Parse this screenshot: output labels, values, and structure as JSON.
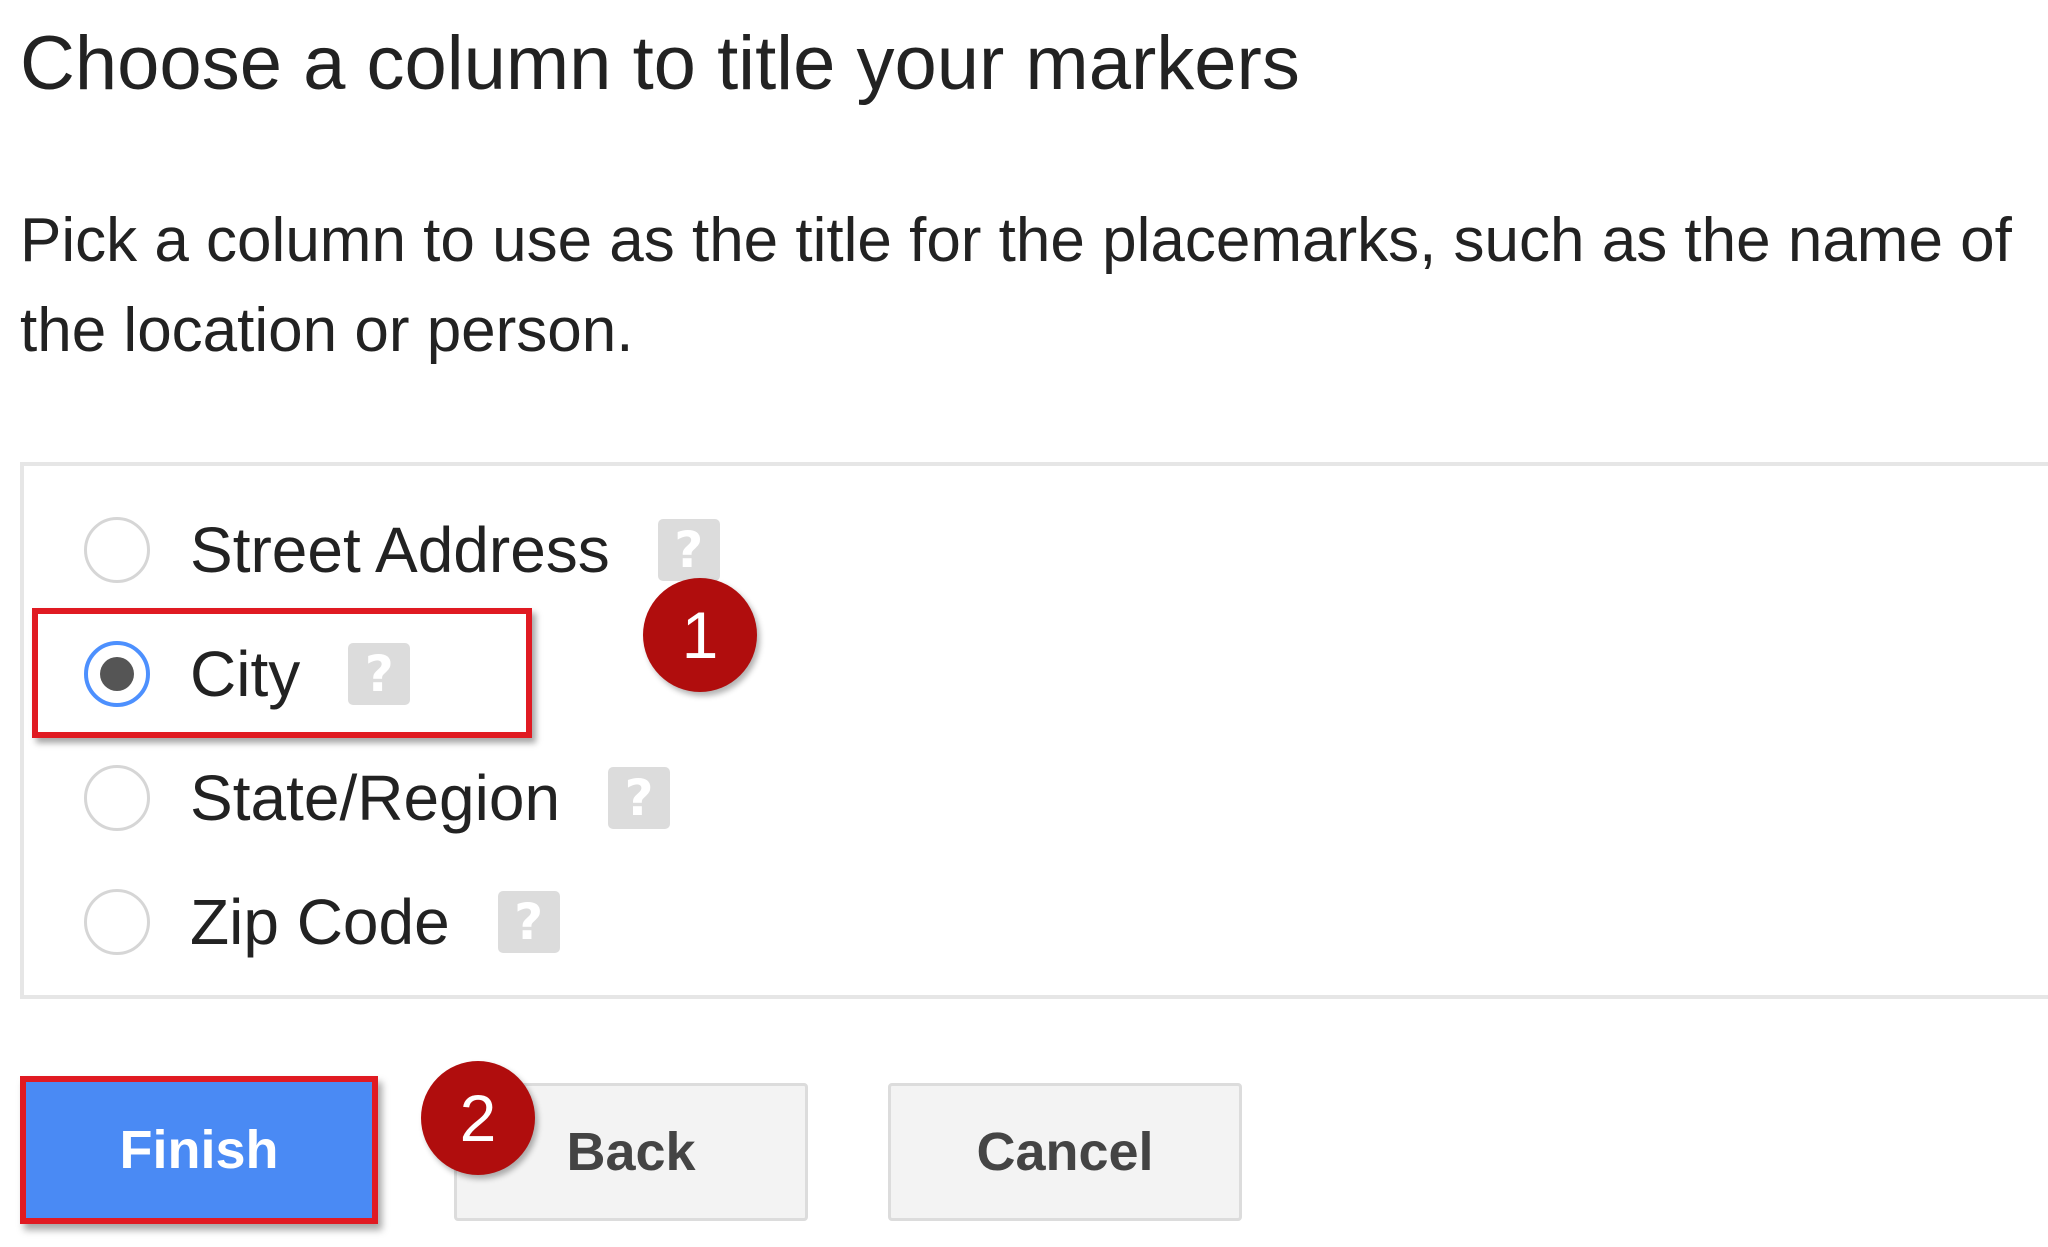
{
  "header": {
    "title": "Choose a column to title your markers"
  },
  "description": "Pick a column to use as the title for the placemarks, such as the name of the location or person.",
  "options": [
    {
      "label": "Street Address",
      "selected": false,
      "help_icon": "help-icon",
      "help_glyph": "?"
    },
    {
      "label": "City",
      "selected": true,
      "help_icon": "help-icon",
      "help_glyph": "?"
    },
    {
      "label": "State/Region",
      "selected": false,
      "help_icon": "help-icon",
      "help_glyph": "?"
    },
    {
      "label": "Zip Code",
      "selected": false,
      "help_icon": "help-icon",
      "help_glyph": "?"
    }
  ],
  "annotations": {
    "step_1": "1",
    "step_2": "2",
    "highlight_color": "#e01a22",
    "badge_color": "#b00d0d"
  },
  "buttons": {
    "finish": "Finish",
    "back": "Back",
    "cancel": "Cancel"
  },
  "colors": {
    "primary_button": "#4a8af4",
    "radio_selected_ring": "#4d90fe",
    "help_icon_bg": "#dcdcdc"
  }
}
